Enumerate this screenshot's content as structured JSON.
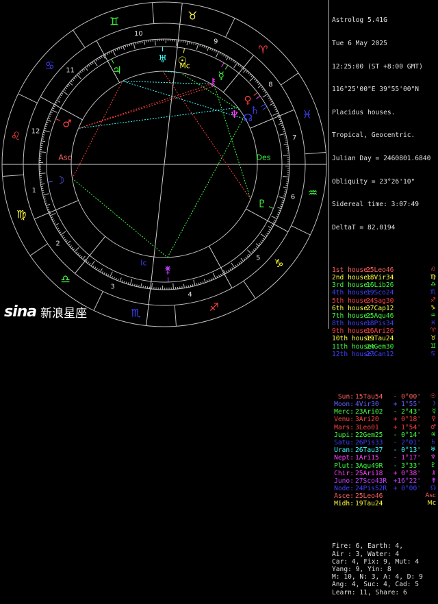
{
  "header": {
    "program": "Astrolog 5.41G",
    "date": "Tue 6 May 2025",
    "time": "12:25:00 (ST +8:00 GMT)",
    "location": "116°25'00\"E 39°55'00\"N",
    "houses": "Placidus houses.",
    "zodiac": "Tropical, Geocentric.",
    "julian": "Julian Day = 2460801.6840",
    "obliquity": "Obliquity = 23°26'10\"",
    "sidereal": "Sidereal time: 3:07:49",
    "deltat": "DeltaT = 82.0194"
  },
  "house_cusps": [
    {
      "label": "1st house:",
      "value": "25Leo46",
      "color": "#ff6060",
      "glyph": "♌"
    },
    {
      "label": "2nd house:",
      "value": "18Vir34",
      "color": "#ffff40",
      "glyph": "♍"
    },
    {
      "label": "3rd house:",
      "value": "16Lib26",
      "color": "#40ff40",
      "glyph": "♎"
    },
    {
      "label": "4th house:",
      "value": "19Sco24",
      "color": "#4040ff",
      "glyph": "♏"
    },
    {
      "label": "5th house:",
      "value": "24Sag30",
      "color": "#ff4040",
      "glyph": "♐"
    },
    {
      "label": "6th house:",
      "value": "27Cap12",
      "color": "#ffff40",
      "glyph": "♑"
    },
    {
      "label": "7th house:",
      "value": "25Aqu46",
      "color": "#40ff40",
      "glyph": "♒"
    },
    {
      "label": "8th house:",
      "value": "18Pis34",
      "color": "#4040ff",
      "glyph": "♓"
    },
    {
      "label": "9th house:",
      "value": "16Ari26",
      "color": "#ff4040",
      "glyph": "♈"
    },
    {
      "label": "10th house:",
      "value": "19Tau24",
      "color": "#ffff40",
      "glyph": "♉"
    },
    {
      "label": "11th house:",
      "value": "24Gem30",
      "color": "#40ff40",
      "glyph": "♊"
    },
    {
      "label": "12th house:",
      "value": "27Can12",
      "color": "#4040ff",
      "glyph": "♋"
    }
  ],
  "planets": [
    {
      "label": "Sun:",
      "pos": "15Tau54",
      "asp": "- 0°00'",
      "color": "#ff6060",
      "glyph": "☉"
    },
    {
      "label": "Moon:",
      "pos": "4Vir30",
      "asp": "+ 1°55'",
      "color": "#6060ff",
      "glyph": "☽"
    },
    {
      "label": "Merc:",
      "pos": "23Ari02",
      "asp": "- 2°43'",
      "color": "#40ff40",
      "glyph": "☿"
    },
    {
      "label": "Venu:",
      "pos": "3Ari20",
      "asp": "+ 0°18'",
      "color": "#ff4040",
      "glyph": "♀"
    },
    {
      "label": "Mars:",
      "pos": "3Leo01",
      "asp": "+ 1°54'",
      "color": "#ff4040",
      "glyph": "♂"
    },
    {
      "label": "Jupi:",
      "pos": "22Gem25",
      "asp": "- 0°14'",
      "color": "#40ff40",
      "glyph": "♃"
    },
    {
      "label": "Satu:",
      "pos": "26Pis33",
      "asp": "- 2°01'",
      "color": "#4040ff",
      "glyph": "♄"
    },
    {
      "label": "Uran:",
      "pos": "26Tau37",
      "asp": "- 0°13'",
      "color": "#40ffff",
      "glyph": "♅"
    },
    {
      "label": "Nept:",
      "pos": "1Ari15",
      "asp": "- 1°17'",
      "color": "#ff40ff",
      "glyph": "♆"
    },
    {
      "label": "Plut:",
      "pos": "3Aqu49R",
      "asp": "- 3°33'",
      "color": "#40ff40",
      "glyph": "♇"
    },
    {
      "label": "Chir:",
      "pos": "25Ari18",
      "asp": "+ 0°38'",
      "color": "#ff40ff",
      "glyph": "⚷"
    },
    {
      "label": "Juno:",
      "pos": "27Sco43R",
      "asp": "+16°22'",
      "color": "#c040ff",
      "glyph": "⚵"
    },
    {
      "label": "Node:",
      "pos": "24Pis52R",
      "asp": "+ 0°00'",
      "color": "#4040ff",
      "glyph": "☊"
    },
    {
      "label": "Asce:",
      "pos": "25Leo46",
      "asp": "",
      "color": "#ff6060",
      "glyph": "Asc"
    },
    {
      "label": "Midh:",
      "pos": "19Tau24",
      "asp": "",
      "color": "#ffff40",
      "glyph": "Mc"
    }
  ],
  "summary": [
    "Fire: 6, Earth: 4,",
    "Air : 3, Water: 4",
    "Car: 4, Fix: 9, Mut: 4",
    "Yang: 9, Yin: 8",
    "M: 10, N: 3, A: 4, D: 9",
    "Ang: 4, Suc: 4, Cad: 5",
    "Learn: 11, Share: 6"
  ],
  "watermark": {
    "logo": "sina",
    "text": "新浪星座"
  },
  "wheel": {
    "signs": [
      {
        "glyph": "♈",
        "color": "#ff4040"
      },
      {
        "glyph": "♉",
        "color": "#ffff40"
      },
      {
        "glyph": "♊",
        "color": "#40ff40"
      },
      {
        "glyph": "♋",
        "color": "#4040ff"
      },
      {
        "glyph": "♌",
        "color": "#ff4040"
      },
      {
        "glyph": "♍",
        "color": "#ffff40"
      },
      {
        "glyph": "♎",
        "color": "#40ff40"
      },
      {
        "glyph": "♏",
        "color": "#4040ff"
      },
      {
        "glyph": "♐",
        "color": "#ff4040"
      },
      {
        "glyph": "♑",
        "color": "#ffff40"
      },
      {
        "glyph": "♒",
        "color": "#40ff40"
      },
      {
        "glyph": "♓",
        "color": "#4040ff"
      }
    ],
    "house_numbers": [
      "1",
      "2",
      "3",
      "4",
      "5",
      "6",
      "7",
      "8",
      "9",
      "10",
      "11",
      "12"
    ],
    "asc_label": "Asc",
    "des_label": "Des",
    "mc_label": "Mc",
    "ic_label": "Ic",
    "asc_deg": 145.77,
    "mc_deg": 49.4,
    "cusp_deg": [
      145.77,
      168.57,
      196.43,
      229.4,
      264.5,
      297.2,
      325.77,
      348.57,
      16.43,
      49.4,
      84.5,
      117.2
    ],
    "bodies": [
      {
        "glyph": "☉",
        "deg": 45.9,
        "color": "#ffff40"
      },
      {
        "glyph": "☽",
        "deg": 154.5,
        "color": "#6060ff"
      },
      {
        "glyph": "☿",
        "deg": 23.03,
        "color": "#40ff40"
      },
      {
        "glyph": "♀",
        "deg": 3.33,
        "color": "#ff4040"
      },
      {
        "glyph": "♂",
        "deg": 123.02,
        "color": "#ff4040"
      },
      {
        "glyph": "♃",
        "deg": 82.42,
        "color": "#40ff40"
      },
      {
        "glyph": "♄",
        "deg": 356.55,
        "color": "#4040ff"
      },
      {
        "glyph": "♅",
        "deg": 56.62,
        "color": "#40ffff"
      },
      {
        "glyph": "♆",
        "deg": 1.25,
        "color": "#ff40ff"
      },
      {
        "glyph": "♇",
        "deg": 303.82,
        "color": "#40ff40"
      },
      {
        "glyph": "⚷",
        "deg": 25.3,
        "color": "#ff40ff"
      },
      {
        "glyph": "⚵",
        "deg": 237.72,
        "color": "#c040ff"
      },
      {
        "glyph": "☊",
        "deg": 354.87,
        "color": "#4040ff"
      }
    ]
  }
}
